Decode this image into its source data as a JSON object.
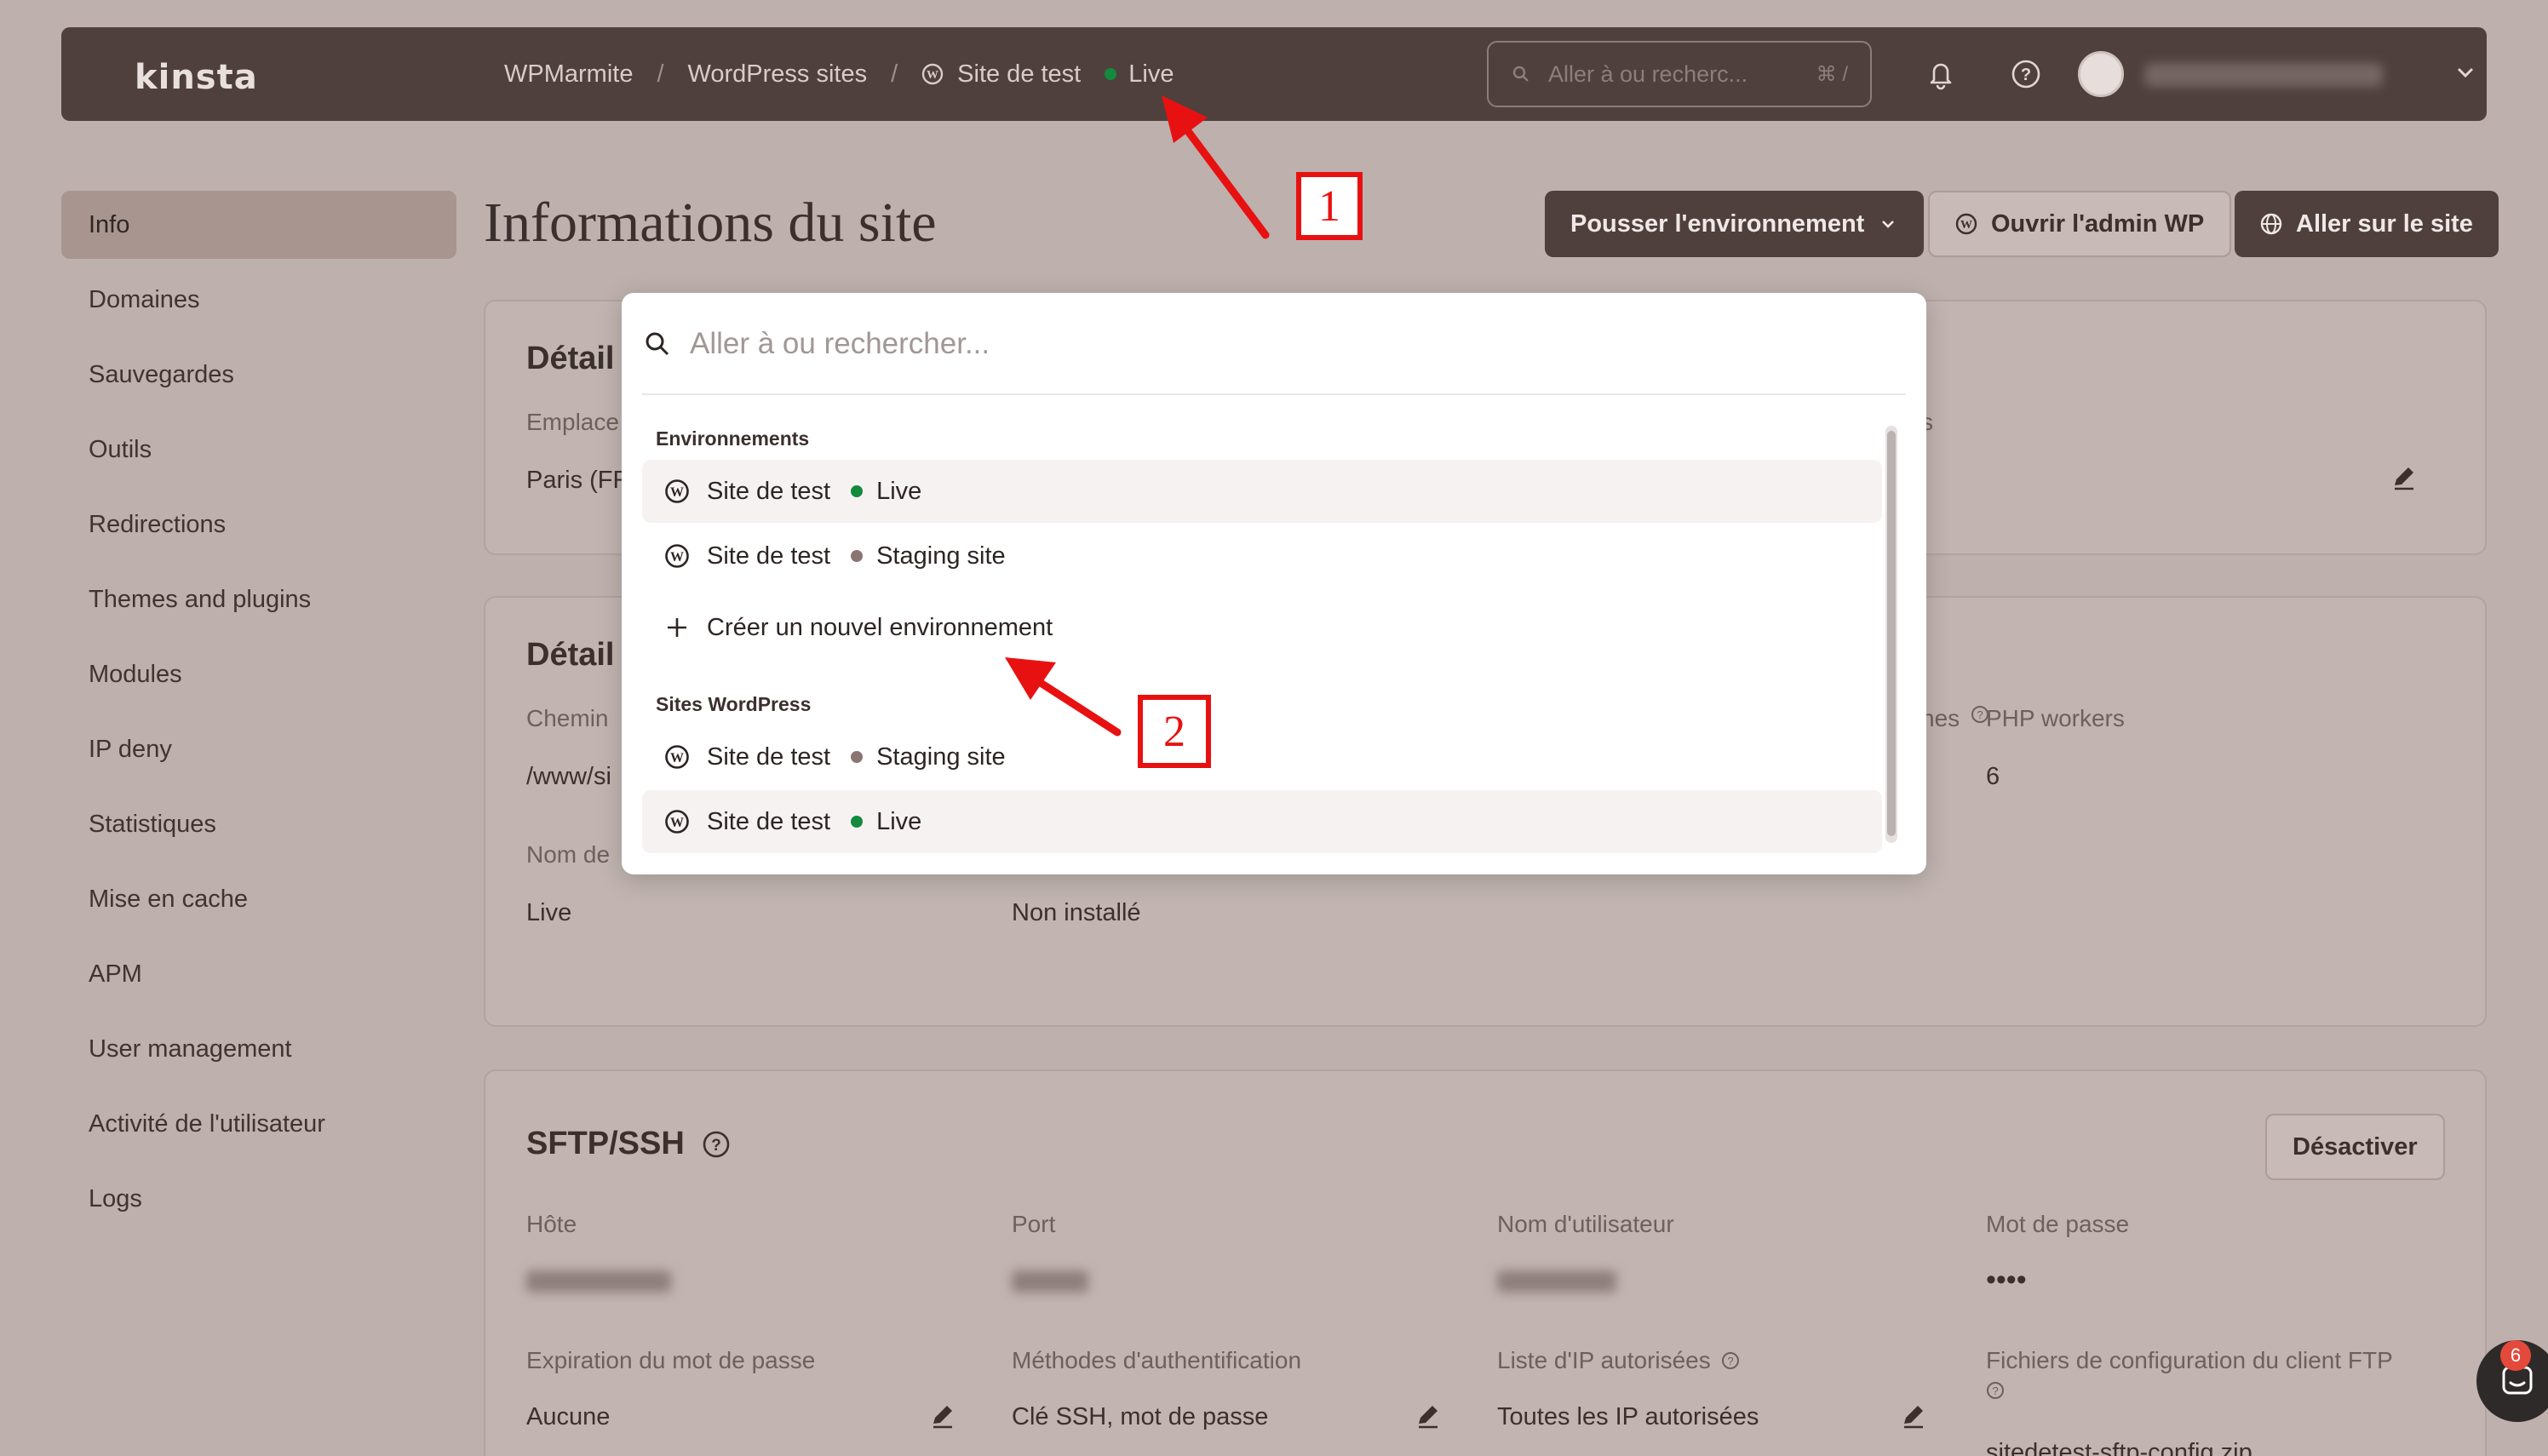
{
  "brand": "kinsta",
  "breadcrumb": {
    "company": "WPMarmite",
    "section": "WordPress sites",
    "site": "Site de test",
    "environment": "Live",
    "separator": "/"
  },
  "top_search": {
    "placeholder": "Aller à ou recherc...",
    "shortcut": "⌘ /"
  },
  "sidebar": {
    "items": [
      {
        "label": "Info",
        "active": true
      },
      {
        "label": "Domaines"
      },
      {
        "label": "Sauvegardes"
      },
      {
        "label": "Outils"
      },
      {
        "label": "Redirections"
      },
      {
        "label": "Themes and plugins"
      },
      {
        "label": "Modules"
      },
      {
        "label": "IP deny"
      },
      {
        "label": "Statistiques"
      },
      {
        "label": "Mise en cache"
      },
      {
        "label": "APM"
      },
      {
        "label": "User management"
      },
      {
        "label": "Activité de l'utilisateur"
      },
      {
        "label": "Logs"
      }
    ]
  },
  "page": {
    "title": "Informations du site",
    "push_button": "Pousser l'environnement",
    "wp_admin_button": "Ouvrir l'admin WP",
    "go_site_button": "Aller sur le site"
  },
  "card1": {
    "title": "Détail",
    "label_location": "Emplace",
    "value_location": "Paris (FR",
    "label_right_partial": "s"
  },
  "card2": {
    "title": "Détail",
    "label_path": "Chemin",
    "value_path": "/www/si",
    "label_name": "Nom de",
    "value_name": "Live",
    "value_plugin": "Non installé",
    "label_right_partial": "nes",
    "label_php": "PHP workers",
    "value_php": "6"
  },
  "sftp": {
    "title": "SFTP/SSH",
    "disable_button": "Désactiver",
    "host_label": "Hôte",
    "port_label": "Port",
    "user_label": "Nom d'utilisateur",
    "password_label": "Mot de passe",
    "password_value": "••••",
    "expiration_label": "Expiration du mot de passe",
    "expiration_value": "Aucune",
    "auth_label": "Méthodes d'authentification",
    "auth_value": "Clé SSH, mot de passe",
    "ip_label": "Liste d'IP autorisées",
    "ip_value": "Toutes les IP autorisées",
    "ftp_config_label": "Fichiers de configuration du client FTP",
    "ftp_config_file": "sitedetest-sftp-config.zip"
  },
  "dropdown": {
    "placeholder": "Aller à ou rechercher...",
    "section_env": "Environnements",
    "env_items": [
      {
        "site": "Site de test",
        "env": "Live",
        "dot": "#138a3e"
      },
      {
        "site": "Site de test",
        "env": "Staging site",
        "dot": "#8a7572"
      }
    ],
    "create_label": "Créer un nouvel environnement",
    "section_sites": "Sites WordPress",
    "site_items": [
      {
        "site": "Site de test",
        "env": "Staging site",
        "dot": "#8a7572"
      },
      {
        "site": "Site de test",
        "env": "Live",
        "dot": "#138a3e"
      }
    ]
  },
  "annotations": {
    "one": "1",
    "two": "2"
  },
  "chat_badge": "6",
  "colors": {
    "accent": "#4f403d",
    "live": "#138a3e",
    "annotation": "#e81111"
  }
}
